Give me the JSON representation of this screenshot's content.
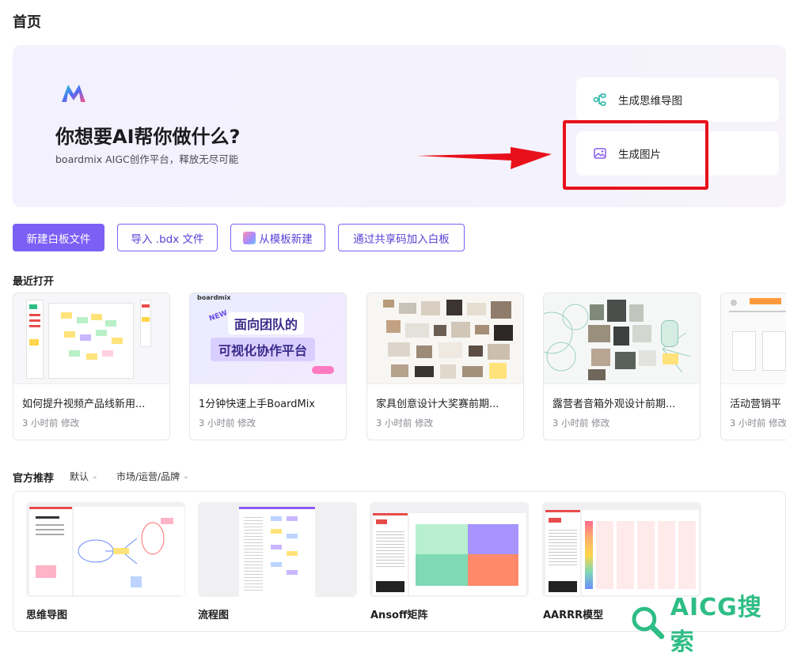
{
  "page": {
    "title": "首页"
  },
  "hero": {
    "title": "你想要AI帮你做什么?",
    "subtitle": "boardmix AIGC创作平台，释放无尽可能",
    "actions": [
      {
        "label": "生成思维导图",
        "icon": "mindmap-icon"
      },
      {
        "label": "生成图片",
        "icon": "image-generate-icon"
      }
    ]
  },
  "buttons": {
    "new_board": "新建白板文件",
    "import": "导入 .bdx 文件",
    "from_template": "从模板新建",
    "join_code": "通过共享码加入白板"
  },
  "recent": {
    "title": "最近打开",
    "items": [
      {
        "name": "如何提升视频产品线新用...",
        "meta": "3 小时前 修改"
      },
      {
        "name": "1分钟快速上手BoardMix",
        "meta": "3 小时前 修改",
        "thumb_brand": "boardmix",
        "thumb_line1": "面向团队的",
        "thumb_line2": "可视化协作平台"
      },
      {
        "name": "家具创意设计大奖赛前期...",
        "meta": "3 小时前 修改"
      },
      {
        "name": "露营者音箱外观设计前期...",
        "meta": "3 小时前 修改"
      },
      {
        "name": "活动营销平",
        "meta": "3 小时前 修改"
      }
    ]
  },
  "official": {
    "title": "官方推荐",
    "filter_default": "默认",
    "filter_category": "市场/运营/品牌",
    "templates": [
      {
        "label": "思维导图"
      },
      {
        "label": "流程图"
      },
      {
        "label": "Ansoff矩阵"
      },
      {
        "label": "AARRR模型"
      }
    ]
  },
  "watermark": {
    "text": "AICG搜索"
  },
  "colors": {
    "accent": "#7b60f6",
    "highlight": "#e8111b",
    "watermark": "#2ebd85"
  }
}
